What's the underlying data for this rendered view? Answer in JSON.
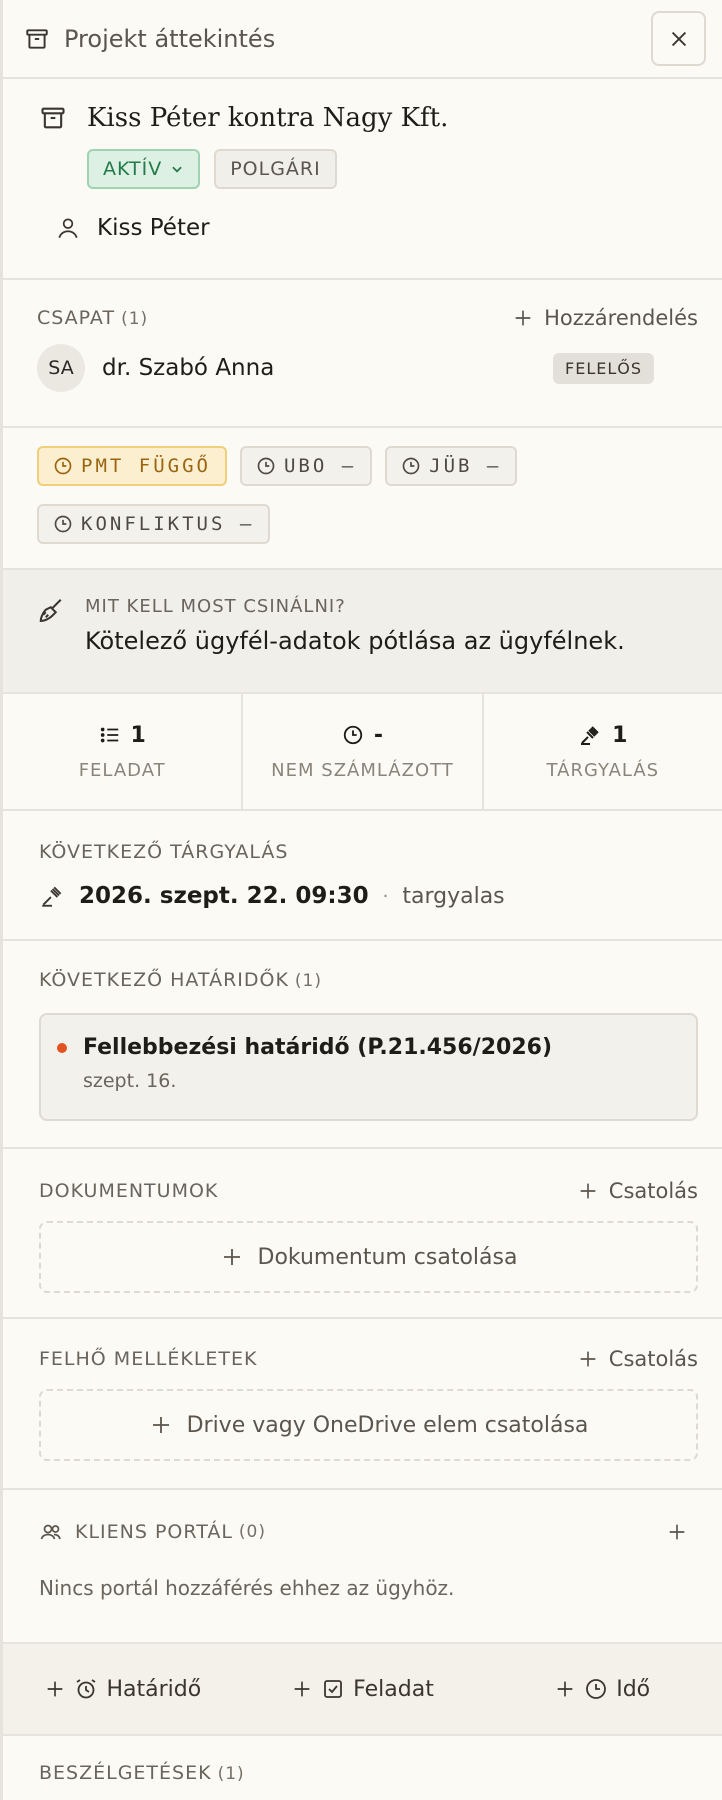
{
  "header": {
    "title": "Projekt áttekintés",
    "icon": "archive-icon",
    "close_icon": "close-icon"
  },
  "project": {
    "title": "Kiss Péter kontra Nagy Kft.",
    "status": "AKTÍV",
    "type": "POLGÁRI",
    "client": "Kiss Péter"
  },
  "team": {
    "label": "CSAPAT",
    "count": "(1)",
    "assign_label": "Hozzárendelés",
    "members": [
      {
        "initials": "SA",
        "name": "dr. Szabó Anna",
        "role": "FELELŐS"
      }
    ]
  },
  "status_chips": [
    {
      "label": "PMT FÜGGŐ",
      "kind": "warn"
    },
    {
      "label": "UBO –",
      "kind": "neutral"
    },
    {
      "label": "JÜB –",
      "kind": "neutral"
    },
    {
      "label": "KONFLIKTUS –",
      "kind": "neutral"
    }
  ],
  "next_action": {
    "label": "MIT KELL MOST CSINÁLNI?",
    "text": "Kötelező ügyfél-adatok pótlása az ügyfélnek."
  },
  "stats": [
    {
      "value": "1",
      "label": "FELADAT",
      "icon": "list-icon"
    },
    {
      "value": "-",
      "label": "NEM SZÁMLÁZOTT",
      "icon": "clock-icon"
    },
    {
      "value": "1",
      "label": "TÁRGYALÁS",
      "icon": "gavel-icon"
    }
  ],
  "next_hearing": {
    "label": "KÖVETKEZŐ TÁRGYALÁS",
    "date": "2026. szept. 22. 09:30",
    "separator": "·",
    "type": "targyalas"
  },
  "deadlines": {
    "label": "KÖVETKEZŐ HATÁRIDŐK",
    "count": "(1)",
    "items": [
      {
        "title": "Fellebbezési határidő (P.21.456/2026)",
        "date": "szept. 16."
      }
    ]
  },
  "documents": {
    "label": "DOKUMENTUMOK",
    "attach_label": "Csatolás",
    "drop_label": "Dokumentum csatolása"
  },
  "cloud": {
    "label": "FELHŐ MELLÉKLETEK",
    "attach_label": "Csatolás",
    "drop_label": "Drive vagy OneDrive elem csatolása"
  },
  "portal": {
    "label": "KLIENS PORTÁL",
    "count": "(0)",
    "empty_text": "Nincs portál hozzáférés ehhez az ügyhöz."
  },
  "quick_actions": [
    {
      "label": "Határidő",
      "icon": "alarm-icon"
    },
    {
      "label": "Feladat",
      "icon": "checkbox-icon"
    },
    {
      "label": "Idő",
      "icon": "clock-icon"
    }
  ],
  "conversations": {
    "label": "BESZÉLGETÉSEK",
    "count": "(1)"
  }
}
